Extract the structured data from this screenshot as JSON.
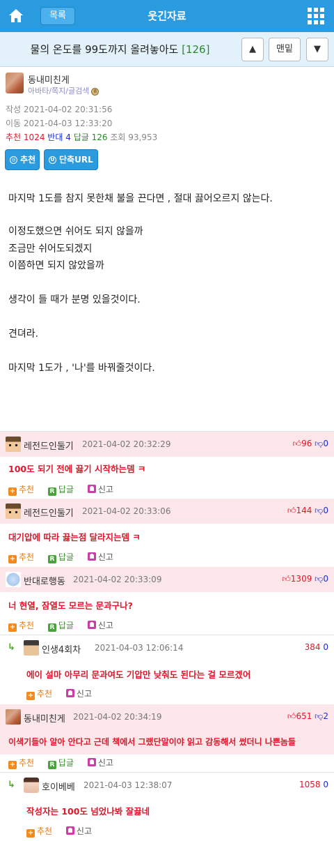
{
  "topbar": {
    "list_label": "목록",
    "board_title": "웃긴자료"
  },
  "post": {
    "title": "물의 온도를 99도까지 올려놓아도",
    "comment_count": "[126]",
    "nav": {
      "up": "▲",
      "bottom": "맨밑",
      "down": "▼"
    },
    "author": {
      "name": "동내미친게",
      "links": "아바타/쪽지/글검색",
      "level_icon": "8"
    },
    "written": "작성 2021-04-02 20:31:56",
    "moved": "이동 2021-04-03 12:33:20",
    "stats": {
      "rec_label": "추천",
      "rec": "1024",
      "opp_label": "반대",
      "opp": "4",
      "rep_label": "답글",
      "rep": "126",
      "view_label": "조회",
      "view": "93,953"
    },
    "buttons": {
      "recommend": "추천",
      "shorturl": "단축URL"
    },
    "body": [
      "마지막 1도를 참지 못한채 불을 끈다면 , 절대 끓어오르지 않는다.",
      "이정도했으면 쉬어도 되지 않을까",
      "조금만 쉬어도되겠지",
      "이쯤하면 되지 않았을까",
      "생각이 들 때가 분명 있을것이다.",
      "견뎌라.",
      "마지막 1도가 , '나'를 바꿔줄것이다."
    ]
  },
  "labels": {
    "recommend": "추천",
    "reply": "답글",
    "report": "신고"
  },
  "comments": [
    {
      "name": "레전드인둘기",
      "date": "2021-04-02 20:32:29",
      "up": "96",
      "down": "0",
      "text": "100도 되기 전에 끓기 시작하는뎀 ㅋ"
    },
    {
      "name": "레전드인둘기",
      "date": "2021-04-02 20:33:06",
      "up": "144",
      "down": "0",
      "text": "대기압에 따라 끓는점 달라지는뎀 ㅋ"
    },
    {
      "name": "반대로행동",
      "date": "2021-04-02 20:33:09",
      "up": "1309",
      "down": "0",
      "text": "너 현열, 잠열도 모르는 문과구나?"
    },
    {
      "name": "인생4회차",
      "date": "2021-04-03 12:06:14",
      "up": "384",
      "down": "0",
      "text": "에이 설마 아무리 문과여도 기압만 낮춰도 된다는 걸 모르겠어"
    },
    {
      "name": "동내미친게",
      "date": "2021-04-02 20:34:19",
      "up": "651",
      "down": "2",
      "text": "이색기들아 알아 안다고 근데 책에서 그랬단말이야 읽고 감동해서 썼더니 나쁜놈들"
    },
    {
      "name": "호이베베",
      "date": "2021-04-03 12:38:07",
      "up": "1058",
      "down": "0",
      "text": "작성자는 100도 넘었나봐 잘끓네"
    }
  ]
}
